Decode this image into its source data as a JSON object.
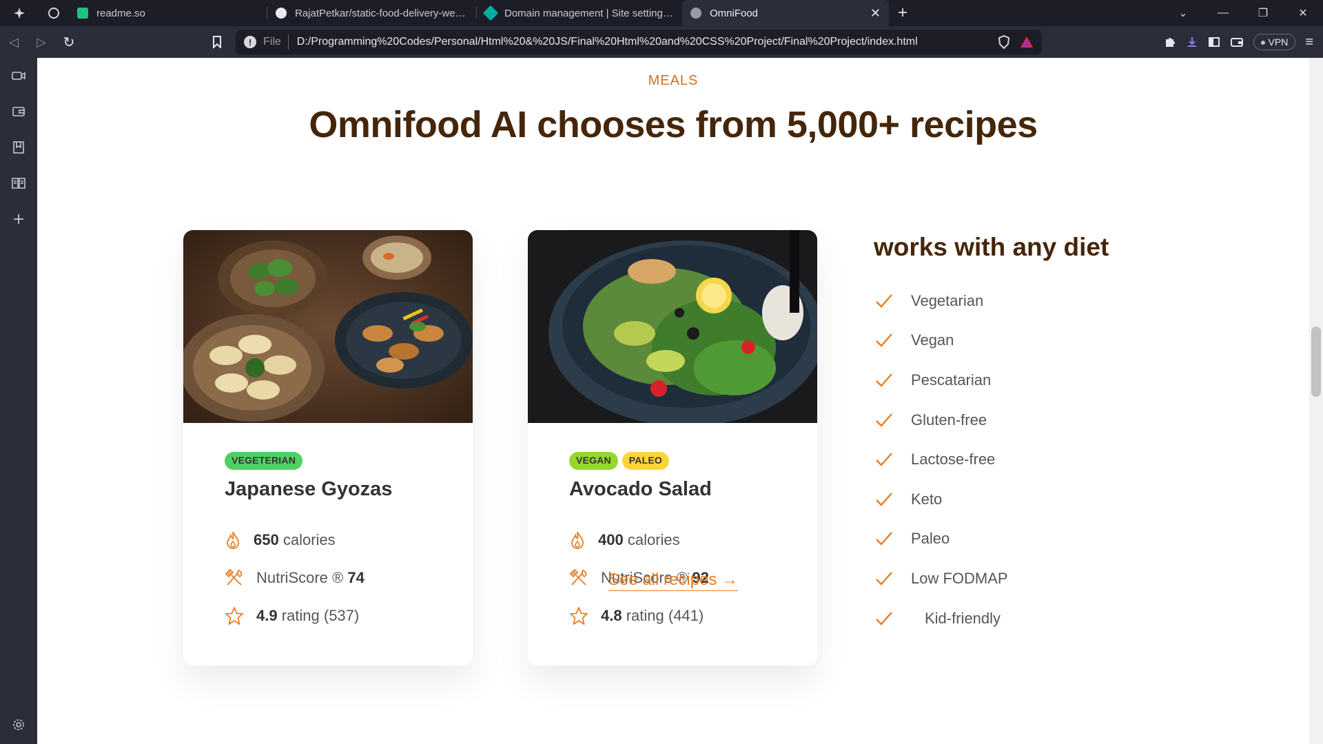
{
  "browser": {
    "tabs": [
      {
        "label": "readme.so",
        "color": "#1bc47d"
      },
      {
        "label": "RajatPetkar/static-food-delivery-website",
        "color": "#e8e8ee"
      },
      {
        "label": "Domain management | Site settings | s",
        "color": "#00ad9f"
      },
      {
        "label": "OmniFood",
        "color": "#9a9ba8"
      }
    ],
    "address": {
      "scheme": "File",
      "url": "D:/Programming%20Codes/Personal/Html%20&%20JS/Final%20Html%20and%20CSS%20Project/Final%20Project/index.html"
    },
    "vpn_label": "VPN"
  },
  "meals_section": {
    "subheading": "MEALS",
    "heading": "Omnifood AI chooses from 5,000+ recipes",
    "meals": [
      {
        "tags": [
          "VEGETERIAN"
        ],
        "title": "Japanese Gyozas",
        "calories_value": "650",
        "calories_label": "calories",
        "nutri_label": "NutriScore ®",
        "nutri_value": "74",
        "rating_value": "4.9",
        "rating_label": "rating (537)"
      },
      {
        "tags": [
          "VEGAN",
          "PALEO"
        ],
        "title": "Avocado Salad",
        "calories_value": "400",
        "calories_label": "calories",
        "nutri_label": "NutriScore ®",
        "nutri_value": "92",
        "rating_value": "4.8",
        "rating_label": "rating (441)"
      }
    ],
    "diets": {
      "title": "works with any diet",
      "items": [
        "Vegetarian",
        "Vegan",
        "Pescatarian",
        "Gluten-free",
        "Lactose-free",
        "Keto",
        "Paleo",
        "Low FODMAP",
        "Kid-friendly"
      ]
    },
    "see_all": "See all recipes →"
  },
  "colors": {
    "accent": "#e67e22",
    "heading": "#45260a",
    "tag_vegetarian": "#51cf66",
    "tag_vegan": "#94d82d",
    "tag_paleo": "#ffd43b"
  }
}
